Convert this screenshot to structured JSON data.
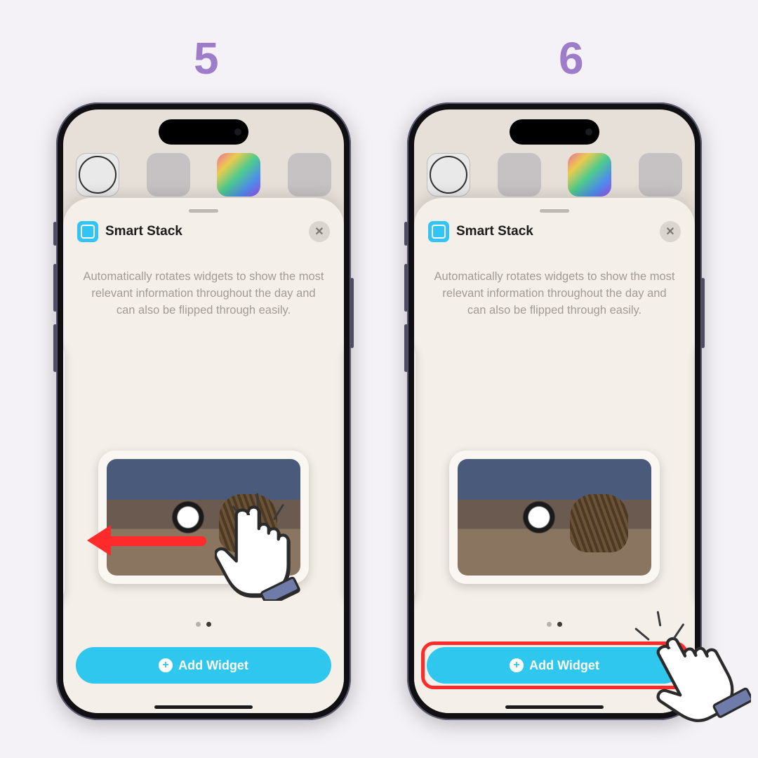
{
  "steps": {
    "left": "5",
    "right": "6"
  },
  "sheet": {
    "title": "Smart Stack",
    "description": "Automatically rotates widgets to show the most relevant information throughout the day and can also be flipped through easily.",
    "add_label": "Add Widget",
    "close_glyph": "✕",
    "plus_glyph": "+"
  }
}
